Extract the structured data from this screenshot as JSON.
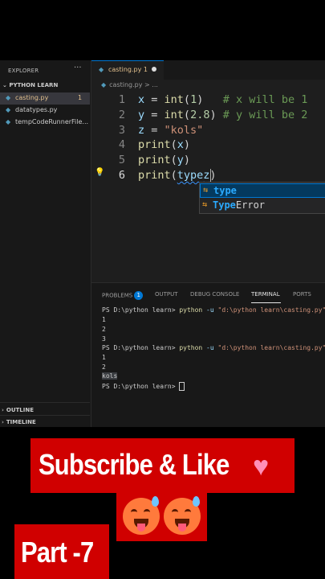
{
  "explorer": {
    "title": "EXPLORER",
    "more": "···",
    "folder": "PYTHON LEARN",
    "files": [
      {
        "name": "casting.py",
        "count": "1",
        "icon": "python-file-icon"
      },
      {
        "name": "datatypes.py",
        "count": "",
        "icon": "python-file-icon"
      },
      {
        "name": "tempCodeRunnerFile...",
        "count": "",
        "icon": "python-file-icon"
      }
    ],
    "outline": "OUTLINE",
    "timeline": "TIMELINE",
    "chevron": "›"
  },
  "editor": {
    "tab": "casting.py 1",
    "breadcrumb": "casting.py > ...",
    "lines": [
      "1",
      "2",
      "3",
      "4",
      "5",
      "6"
    ],
    "code": {
      "l1": {
        "var": "x",
        "eq": " = ",
        "fn": "int",
        "open": "(",
        "num": "1",
        "close": ")",
        "pad": "   ",
        "comment": "# x will be 1"
      },
      "l2": {
        "var": "y",
        "eq": " = ",
        "fn": "int",
        "open": "(",
        "num": "2.8",
        "close": ")",
        "pad": " ",
        "comment": "# y will be 2"
      },
      "l3": {
        "var": "z",
        "eq": " = ",
        "str": "\"kols\""
      },
      "l4": {
        "fn": "print",
        "open": "(",
        "arg": "x",
        "close": ")"
      },
      "l5": {
        "fn": "print",
        "open": "(",
        "arg": "y",
        "close": ")"
      },
      "l6": {
        "fn": "print",
        "open": "(",
        "arg": "typez",
        "close": ")"
      }
    },
    "suggestions": [
      {
        "match": "type",
        "rest": ""
      },
      {
        "match": "Type",
        "rest": "Error"
      }
    ],
    "suggestion_icon": "⇆",
    "bulb": "💡"
  },
  "panel": {
    "tabs": {
      "problems": "PROBLEMS",
      "problems_count": "1",
      "output": "OUTPUT",
      "debug": "DEBUG CONSOLE",
      "terminal": "TERMINAL",
      "ports": "PORTS"
    },
    "prompt": "PS D:\\python learn> ",
    "cmd": "python",
    "flag": " -u ",
    "path": "\"d:\\python learn\\casting.py\"",
    "out1": [
      "1",
      "2",
      "3"
    ],
    "out2": [
      "1",
      "2"
    ],
    "out2_sel": "kols"
  },
  "overlay": {
    "subscribe": "Subscribe & Like",
    "heart": "♥",
    "part": "Part -7"
  },
  "colors": {
    "banner": "#d00000",
    "accent": "#0078d4"
  }
}
